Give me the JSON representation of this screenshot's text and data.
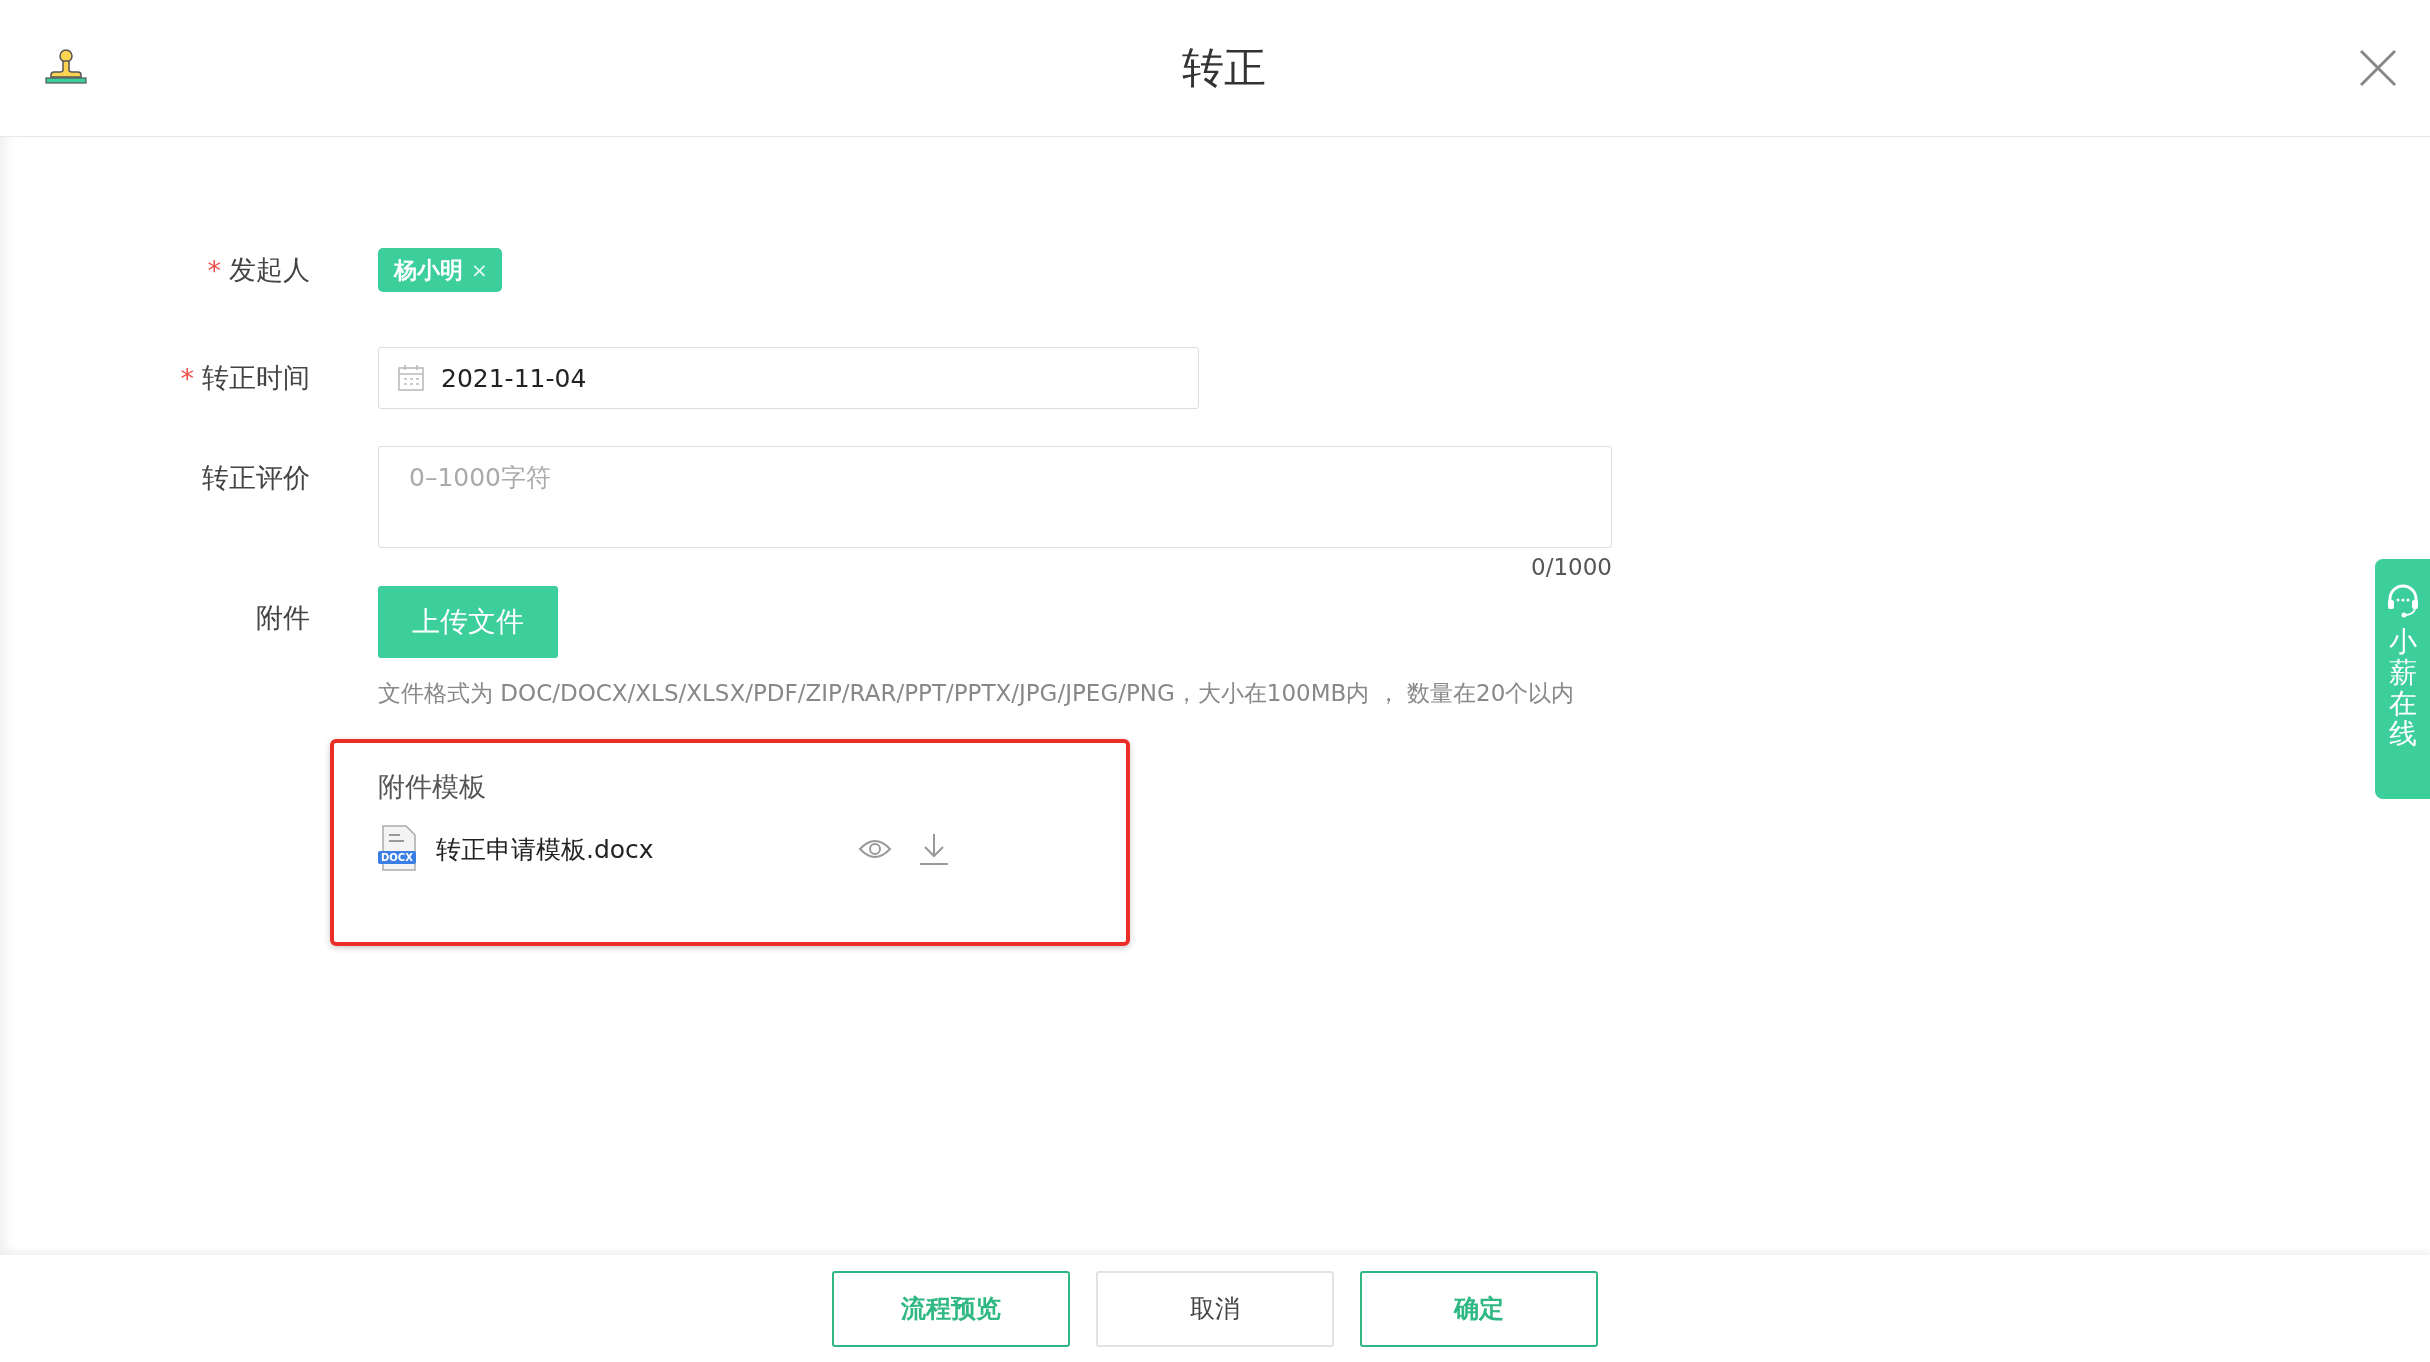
{
  "header": {
    "title": "转正"
  },
  "form": {
    "fields": [
      {
        "kind": "tags",
        "label": "发起人",
        "required_mark": "*",
        "tags": [
          {
            "label": "杨小明",
            "remove": "×"
          }
        ]
      },
      {
        "kind": "date",
        "label": "转正时间",
        "required_mark": "*",
        "value": "2021-11-04"
      },
      {
        "kind": "textarea",
        "label": "转正评价",
        "placeholder": "0–1000字符",
        "counter": "0/1000"
      },
      {
        "kind": "upload",
        "label": "附件",
        "button": "上传文件",
        "hint": "文件格式为 DOC/DOCX/XLS/XLSX/PDF/ZIP/RAR/PPT/PPTX/JPG/JPEG/PNG，大小在100MB内 ， 数量在20个以内"
      }
    ]
  },
  "template": {
    "title": "附件模板",
    "files": [
      {
        "name": "转正申请模板.docx",
        "type_label": "DOCX"
      }
    ]
  },
  "side_widget": {
    "label": "小薪在线"
  },
  "footer": {
    "buttons": [
      {
        "label": "流程预览",
        "kind": "outline"
      },
      {
        "label": "取消",
        "kind": "plain"
      },
      {
        "label": "确定",
        "kind": "outline"
      }
    ]
  }
}
